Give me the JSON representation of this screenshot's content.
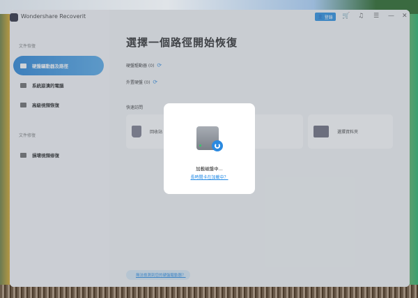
{
  "app": {
    "title": "Wondershare Recoverit"
  },
  "toolbar": {
    "login": "登錄",
    "icons": [
      "cart-icon",
      "headset-icon",
      "menu-icon",
      "minimize-icon",
      "close-icon"
    ]
  },
  "sidebar": {
    "section1": "文件恢復",
    "items": [
      {
        "label": "硬盤驅動器及路徑",
        "active": true
      },
      {
        "label": "系統崩潰的電腦"
      },
      {
        "label": "高級視頻恢復"
      }
    ],
    "section2": "文件修復",
    "items2": [
      {
        "label": "損壞視頻修復"
      }
    ]
  },
  "main": {
    "title": "選擇一個路徑開始恢復",
    "hard_drives": "硬盤驅動器 (0)",
    "external": "外置硬盤 (0)",
    "quick_access": "快速訪問",
    "cards": [
      "回收站",
      "選擇資料夾"
    ],
    "help_link": "無法檢測到您的硬盤驅動器？"
  },
  "modal": {
    "status": "加載磁盤中...",
    "link": "長時間卡在加載中？"
  },
  "colors": {
    "accent": "#1f7fd6"
  }
}
